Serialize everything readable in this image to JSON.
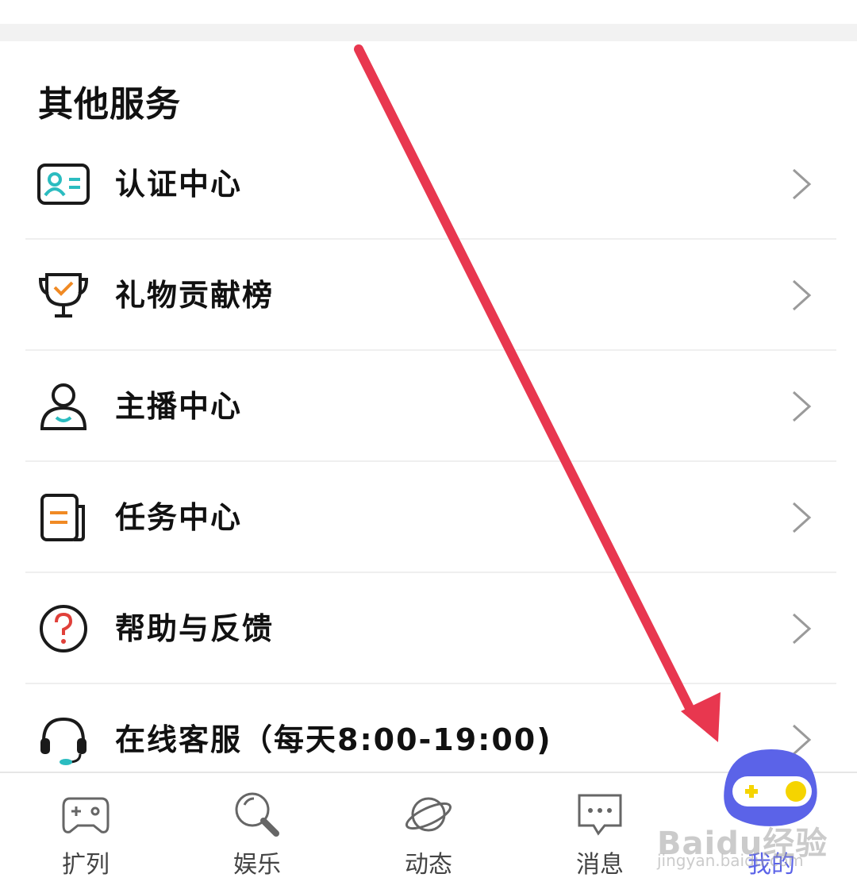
{
  "section": {
    "title": "其他服务"
  },
  "menu": [
    {
      "label": "认证中心",
      "icon": "id-card-icon"
    },
    {
      "label": "礼物贡献榜",
      "icon": "trophy-icon"
    },
    {
      "label": "主播中心",
      "icon": "user-icon"
    },
    {
      "label": "任务中心",
      "icon": "task-document-icon"
    },
    {
      "label": "帮助与反馈",
      "icon": "question-icon"
    },
    {
      "label": "在线客服（每天8:00-19:00)",
      "icon": "headset-icon"
    }
  ],
  "bottom_nav": {
    "items": [
      {
        "label": "扩列",
        "icon": "gamepad-icon"
      },
      {
        "label": "娱乐",
        "icon": "magnifier-icon"
      },
      {
        "label": "动态",
        "icon": "planet-icon"
      },
      {
        "label": "消息",
        "icon": "chat-bubble-icon"
      },
      {
        "label": "我的",
        "icon": "avatar-icon",
        "active": true
      }
    ]
  },
  "watermark": {
    "logo": "Baidu经验",
    "url": "jingyan.baidu.com"
  },
  "colors": {
    "accent": "#5b63e8",
    "arrow": "#e8374f",
    "teal": "#2bbcc0",
    "orange": "#f08a24"
  }
}
